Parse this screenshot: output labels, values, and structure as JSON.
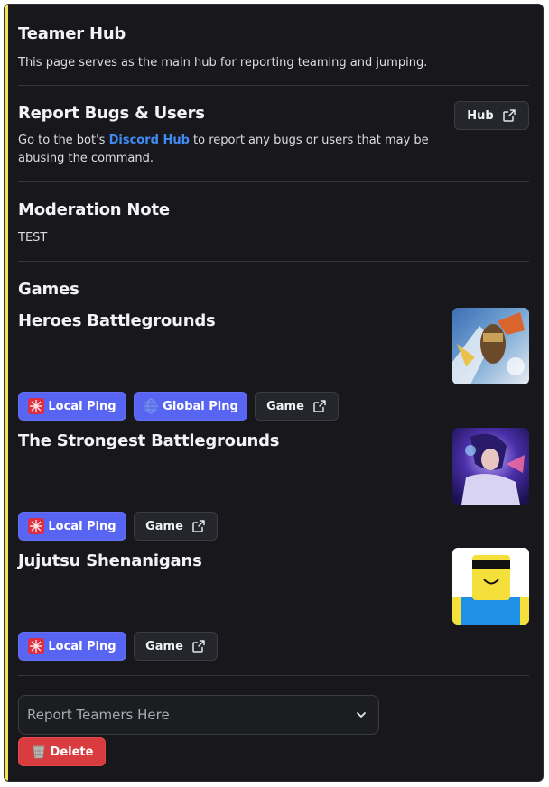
{
  "hub": {
    "title": "Teamer Hub",
    "description": "This page serves as the main hub for reporting teaming and jumping."
  },
  "report": {
    "title": "Report Bugs & Users",
    "text_before": "Go to the bot's ",
    "link_text": "Discord Hub",
    "text_after": " to report any bugs or users that may be abusing the command.",
    "button_label": "Hub"
  },
  "moderation": {
    "title": "Moderation Note",
    "note": "TEST"
  },
  "games": {
    "heading": "Games",
    "items": [
      {
        "name": "Heroes Battlegrounds",
        "local_label": "Local Ping",
        "global_label": "Global Ping",
        "game_label": "Game",
        "thumb_icon": "heroes-battlegrounds-thumbnail"
      },
      {
        "name": "The Strongest Battlegrounds",
        "local_label": "Local Ping",
        "game_label": "Game",
        "thumb_icon": "strongest-battlegrounds-thumbnail"
      },
      {
        "name": "Jujutsu Shenanigans",
        "local_label": "Local Ping",
        "game_label": "Game",
        "thumb_icon": "jujutsu-shenanigans-thumbnail"
      }
    ]
  },
  "select": {
    "placeholder": "Report Teamers Here"
  },
  "delete_button": {
    "label": "Delete"
  },
  "colors": {
    "accent": "#f5e353",
    "blurple": "#5865f2",
    "danger": "#d83c3e",
    "link": "#3f8cf5",
    "background": "#18181c"
  }
}
